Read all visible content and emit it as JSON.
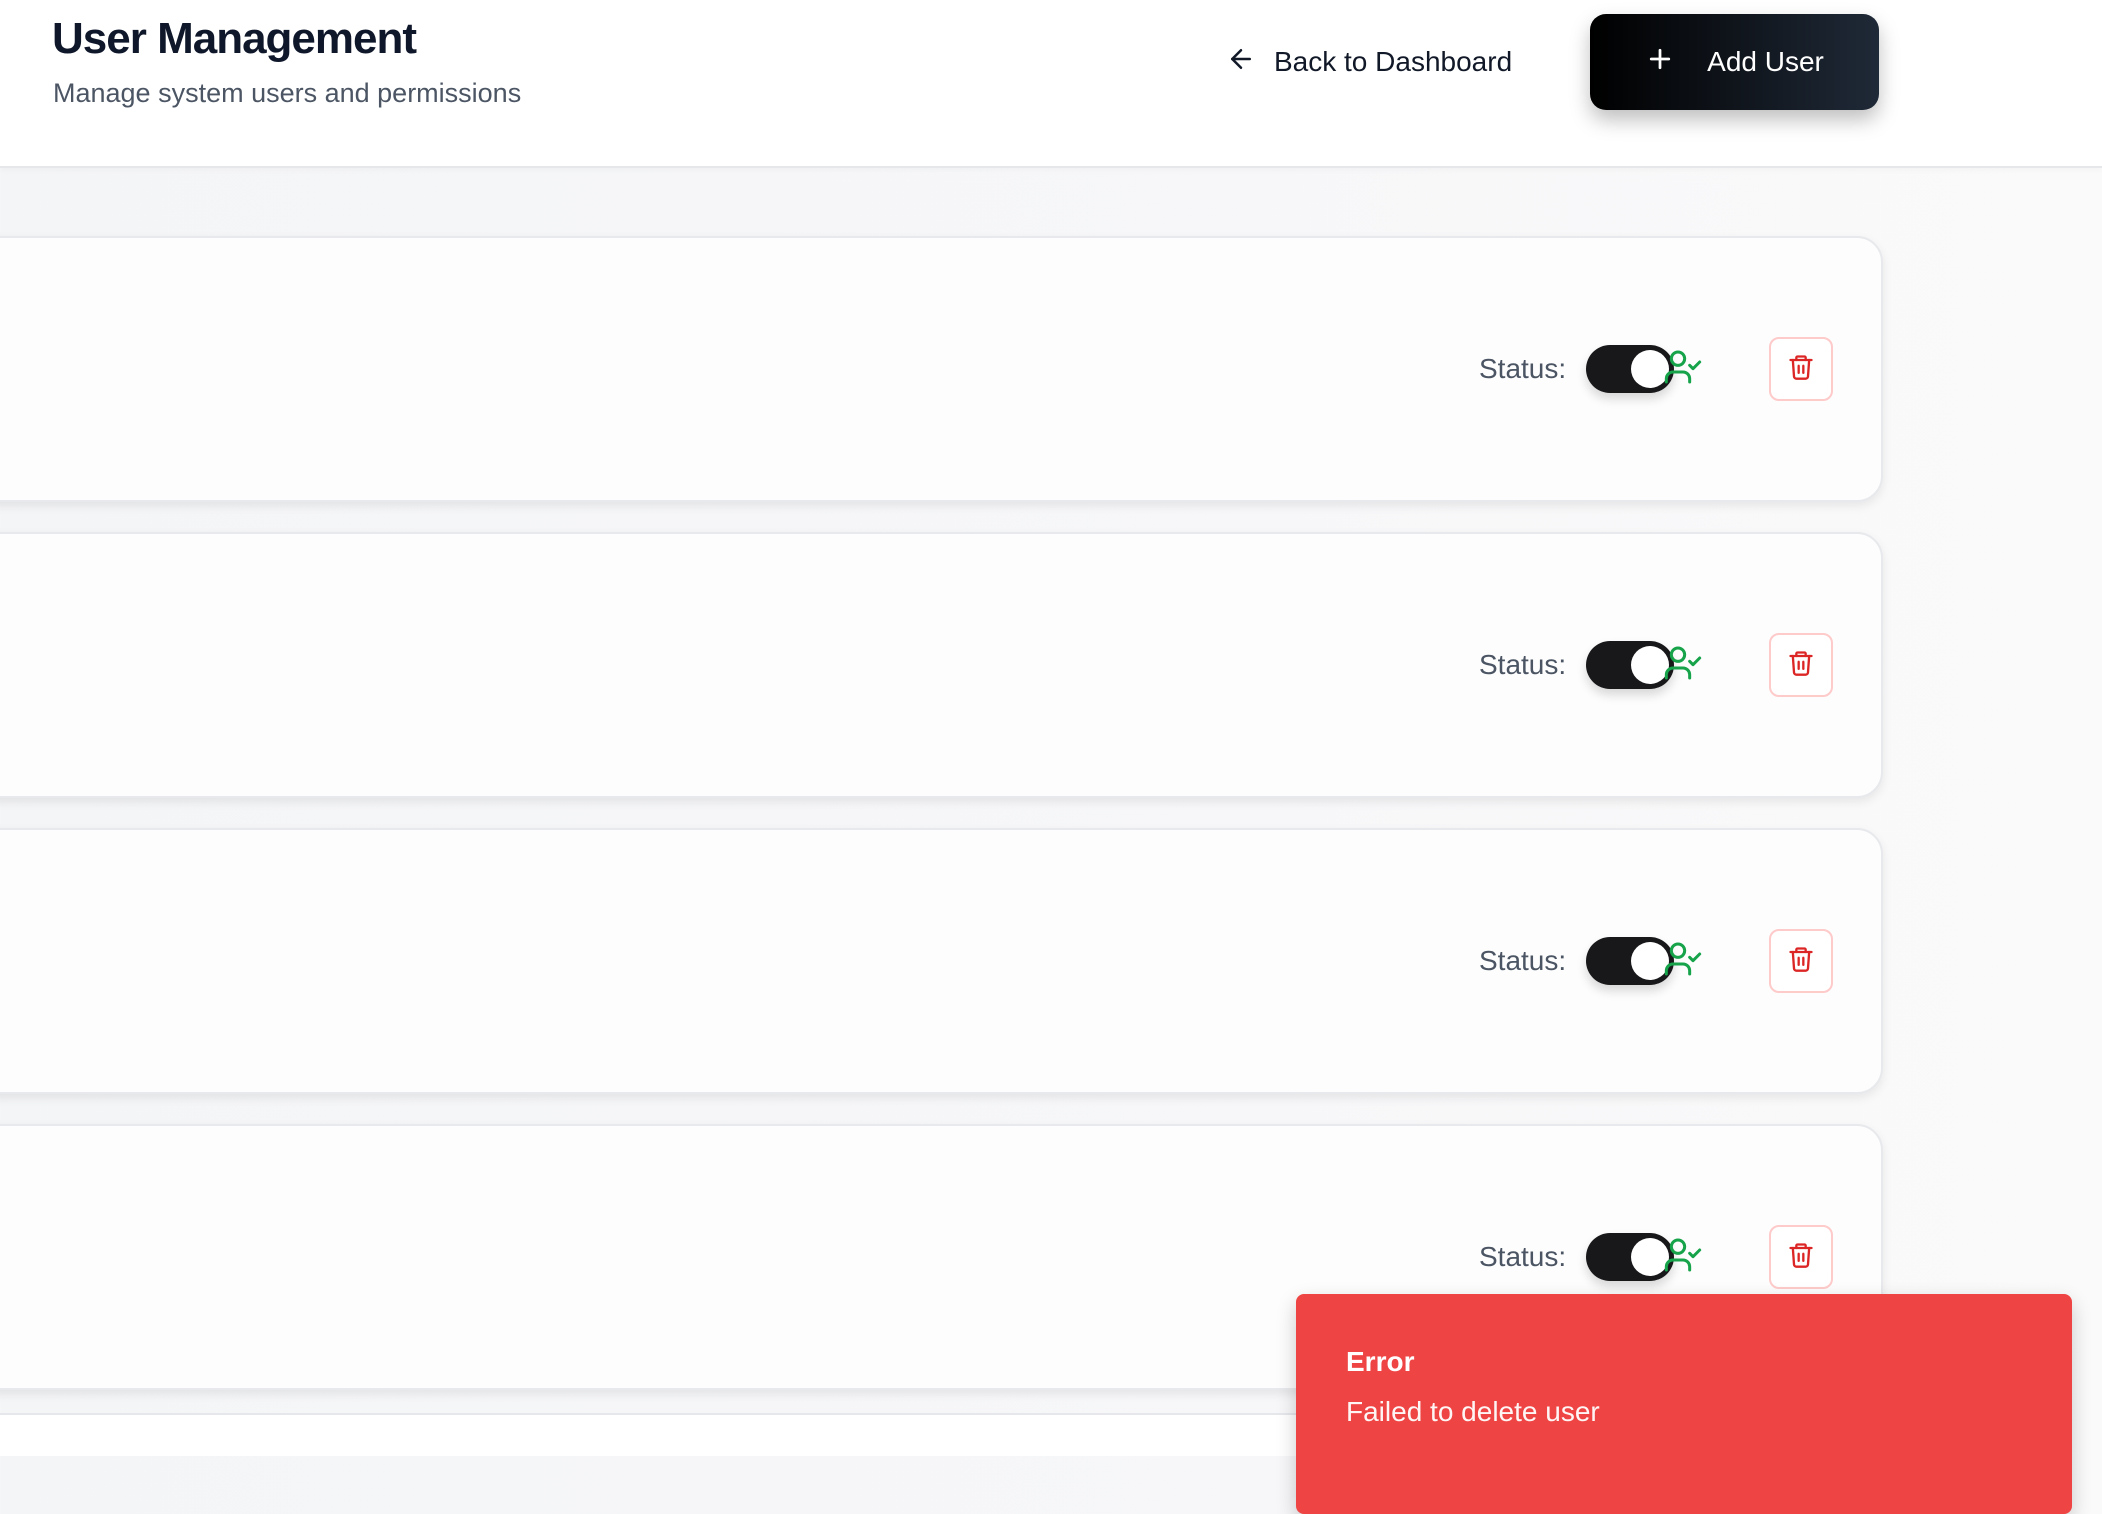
{
  "header": {
    "title": "User Management",
    "subtitle": "Manage system users and permissions",
    "back_label": "Back to Dashboard",
    "add_user_label": "Add User"
  },
  "users": [
    {
      "status_label": "Status:",
      "active": true
    },
    {
      "status_label": "Status:",
      "active": true
    },
    {
      "status_label": "Status:",
      "active": true
    },
    {
      "status_label": "Status:",
      "active": true
    }
  ],
  "toast": {
    "title": "Error",
    "message": "Failed to delete user"
  },
  "colors": {
    "primary": "#000000",
    "success": "#16a34a",
    "danger": "#dc2626",
    "toast_bg": "#ef4444"
  },
  "icons": [
    "arrow-left-icon",
    "plus-icon",
    "user-check-icon",
    "trash-icon"
  ]
}
